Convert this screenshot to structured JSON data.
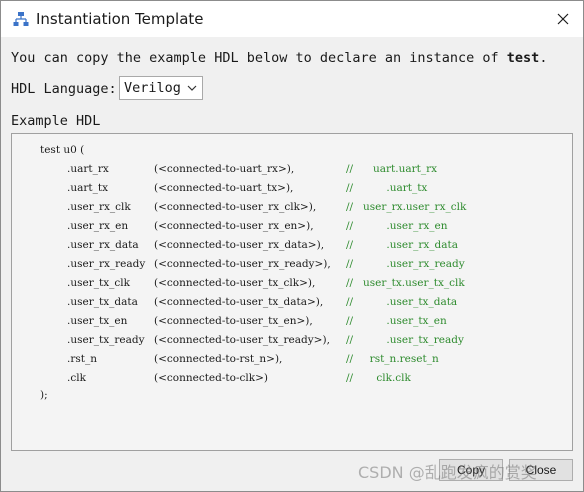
{
  "window": {
    "title": "Instantiation Template",
    "app_icon": "hierarchy-icon",
    "close_icon": "close-icon"
  },
  "intro": {
    "prefix": "You can copy the example HDL below to declare an instance of ",
    "module": "test",
    "suffix": "."
  },
  "language": {
    "label": "HDL Language:",
    "selected": "Verilog"
  },
  "example": {
    "label": "Example HDL",
    "header": "test u0 (",
    "footer": ");",
    "ports": [
      {
        "port": ".uart_rx",
        "conn": "(<connected-to-uart_rx>),",
        "comment": "   uart.uart_rx"
      },
      {
        "port": ".uart_tx",
        "conn": "(<connected-to-uart_tx>),",
        "comment": "       .uart_tx"
      },
      {
        "port": ".user_rx_clk",
        "conn": "(<connected-to-user_rx_clk>),",
        "comment": "user_rx.user_rx_clk"
      },
      {
        "port": ".user_rx_en",
        "conn": "(<connected-to-user_rx_en>),",
        "comment": "       .user_rx_en"
      },
      {
        "port": ".user_rx_data",
        "conn": "(<connected-to-user_rx_data>),",
        "comment": "       .user_rx_data"
      },
      {
        "port": ".user_rx_ready",
        "conn": "(<connected-to-user_rx_ready>),",
        "comment": "       .user_rx_ready"
      },
      {
        "port": ".user_tx_clk",
        "conn": "(<connected-to-user_tx_clk>),",
        "comment": "user_tx.user_tx_clk"
      },
      {
        "port": ".user_tx_data",
        "conn": "(<connected-to-user_tx_data>),",
        "comment": "       .user_tx_data"
      },
      {
        "port": ".user_tx_en",
        "conn": "(<connected-to-user_tx_en>),",
        "comment": "       .user_tx_en"
      },
      {
        "port": ".user_tx_ready",
        "conn": "(<connected-to-user_tx_ready>),",
        "comment": "       .user_tx_ready"
      },
      {
        "port": ".rst_n",
        "conn": "(<connected-to-rst_n>),",
        "comment": "  rst_n.reset_n"
      },
      {
        "port": ".clk",
        "conn": "(<connected-to-clk>)",
        "comment": "    clk.clk"
      }
    ],
    "comment_marker": "//"
  },
  "buttons": {
    "copy": "Copy",
    "close": "Close"
  },
  "watermark": "CSDN @乱跑发疯的赏奖",
  "colors": {
    "comment": "#2e8b2e",
    "window_bg": "#f0f0f0",
    "titlebar_bg": "#ffffff"
  }
}
